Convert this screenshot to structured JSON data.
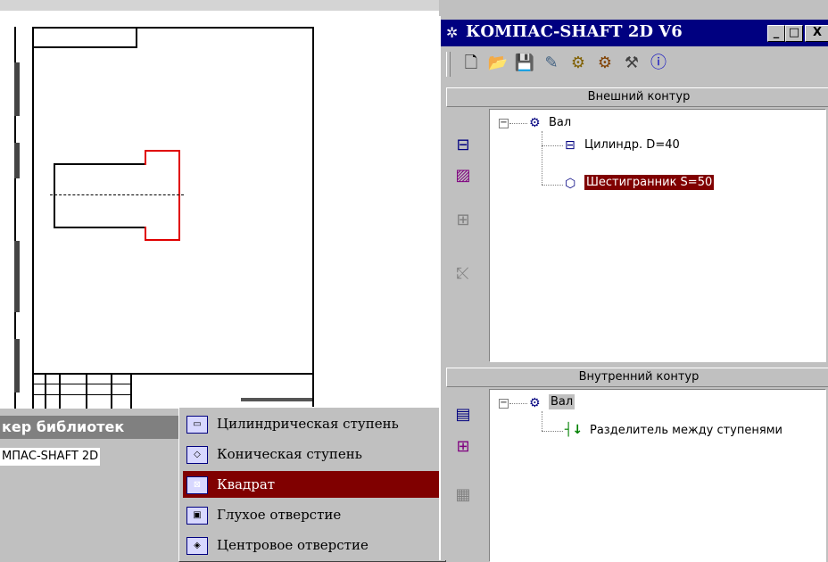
{
  "window": {
    "title": "КОМПАС-SHAFT 2D V6",
    "min_label": "_",
    "max_label": "□",
    "close_label": "X"
  },
  "toolbar": {
    "icons": [
      "new-icon",
      "open-icon",
      "save-icon",
      "edit-icon",
      "gear-icon",
      "gears-icon",
      "tools-icon",
      "info-icon"
    ]
  },
  "outer": {
    "header": "Внешний контур",
    "root": "Вал",
    "items": [
      {
        "label": "Цилиндр. D=40",
        "selected": false
      },
      {
        "label": "Шестигранник S=50",
        "selected": true
      }
    ]
  },
  "inner": {
    "header": "Внутренний контур",
    "root": "Вал",
    "items": [
      {
        "label": "Разделитель между ступенями"
      }
    ]
  },
  "libmanager": {
    "title": "кер библиотек",
    "item": "МПАС-SHAFT 2D"
  },
  "menu": {
    "items": [
      {
        "label": "Цилиндрическая ступень"
      },
      {
        "label": "Коническая ступень"
      },
      {
        "label": "Квадрат",
        "selected": true
      },
      {
        "label": "Глухое отверстие"
      },
      {
        "label": "Центровое отверстие"
      }
    ]
  },
  "colors": {
    "titlebar": "#000080",
    "selection": "#800000",
    "highlight_line": "#e00000"
  }
}
